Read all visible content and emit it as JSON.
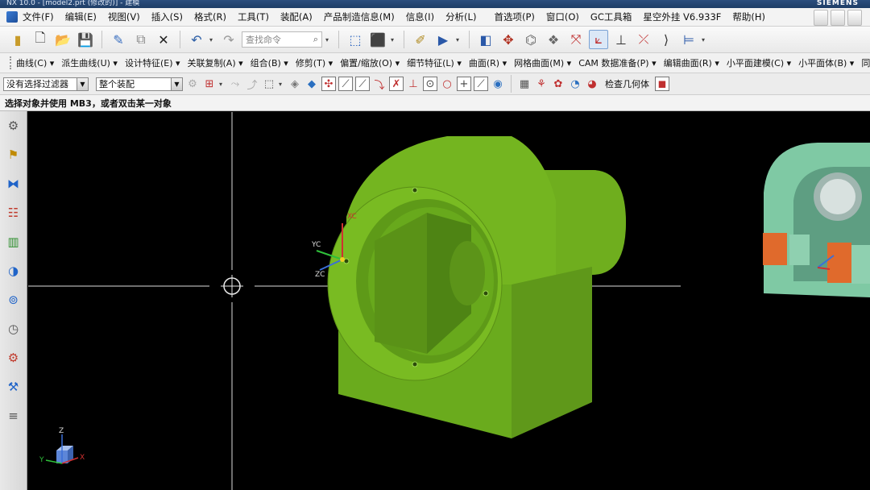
{
  "window": {
    "title": "NX 10.0 - [model2.prt (修改的)] - 建模",
    "brand": "SIEMENS"
  },
  "menubar": {
    "items": [
      "文件(F)",
      "编辑(E)",
      "视图(V)",
      "插入(S)",
      "格式(R)",
      "工具(T)",
      "装配(A)",
      "产品制造信息(M)",
      "信息(I)",
      "分析(L)",
      "首选项(P)",
      "窗口(O)",
      "GC工具箱",
      "星空外挂 V6.933F",
      "帮助(H)"
    ]
  },
  "toolbar": {
    "search_placeholder": "查找命令"
  },
  "feature_toolbar": {
    "items": [
      "曲线(C) ▾",
      "派生曲线(U) ▾",
      "设计特征(E) ▾",
      "关联复制(A) ▾",
      "组合(B) ▾",
      "修剪(T) ▾",
      "偏置/缩放(O) ▾",
      "细节特征(L) ▾",
      "曲面(R) ▾",
      "网格曲面(M) ▾",
      "CAM 数据准备(P) ▾",
      "编辑曲面(R) ▾",
      "小平面建模(C) ▾",
      "小平面体(B) ▾",
      "同步建模(Y) ▾"
    ]
  },
  "selection_bar": {
    "filter_value": "没有选择过滤器",
    "scope_value": "整个装配",
    "check_geometry_label": "检查几何体"
  },
  "cue_line": {
    "text": "选择对象并使用 MB3，或者双击某一对象"
  },
  "viewport": {
    "background": "#000000",
    "part_color": "#6fae1e",
    "wcs_labels": {
      "x": "XC",
      "y": "YC",
      "z": "ZC"
    },
    "triad_labels": {
      "x": "X",
      "y": "Y",
      "z": "Z"
    }
  },
  "icons": [
    "new-file-icon",
    "open-folder-icon",
    "save-icon",
    "undo-icon",
    "redo-icon",
    "search-icon",
    "snap-point-icon",
    "ui-gear-icon"
  ]
}
